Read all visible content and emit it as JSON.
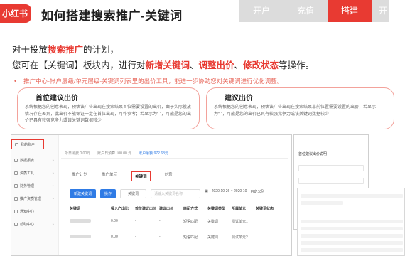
{
  "header": {
    "logo_text": "小红书",
    "title": "如何搭建搜索推广-关键词",
    "tabs": [
      {
        "label": "开户",
        "active": false
      },
      {
        "label": "充值",
        "active": false
      },
      {
        "label": "搭建",
        "active": true
      },
      {
        "label": "开",
        "active": false
      }
    ]
  },
  "intro": {
    "line1_pre": "对于投放",
    "line1_highlight": "搜索推广",
    "line1_post": "的计划，",
    "line2_pre": "您可在【关键词】板块内，进行对",
    "line2_h1": "新增关键词",
    "line2_sep1": "、",
    "line2_h2": "调整出价",
    "line2_sep2": "、",
    "line2_h3": "修改状态",
    "line2_post": "等操作。",
    "note": "推广中心-帐户层级/单元层级-关键词列表里的出价工具，能进一步协助您对关键词进行优化调整。"
  },
  "box_left": {
    "title": "首位建议出价",
    "body": "系统根据您的创意表现，预估该广告出现在搜索结果首位需要设置的出价，由于实际投放情况存在差异，此出价不能保证一定在首位出现，可作参考；若显示为“-”，可能是您的出价已具有较强竞争力或该关键词数据较少"
  },
  "box_right": {
    "title": "建议出价",
    "body": "系统根据您的创意表现，预估该广告出现在搜索结果靠前位置需要设置的出价；若显示为“-”，可能是您的出价已具有较强竞争力或该关键词数据较少"
  },
  "screenshot": {
    "sidebar": [
      {
        "label": "我的账户",
        "selected": true
      },
      {
        "label": "数据报表",
        "selected": false
      },
      {
        "label": "资质工具",
        "selected": false
      },
      {
        "label": "财务管理",
        "selected": false
      },
      {
        "label": "推广资质管理",
        "selected": false
      },
      {
        "label": "通知中心",
        "selected": false
      },
      {
        "label": "帮助中心",
        "selected": false
      }
    ],
    "topbar": [
      "今日消费 0.00元",
      "账户日预算 100.00 元",
      "账户余额 972.68元"
    ],
    "tabs": [
      "推广计划",
      "推广单元",
      "关键词",
      "创意"
    ],
    "active_tab": "关键词",
    "toolbar": {
      "add": "新建关键词",
      "ops": "操作",
      "filter": "关键词",
      "search_placeholder": "请输入关键词名称",
      "date_range": "2020-10-26 ~ 2020-10",
      "customize": "自定义列"
    },
    "columns": [
      "关键词",
      "投入产出比",
      "首位建议出价",
      "建议出价",
      "匹配方式",
      "关键词类型",
      "所属单元",
      "关键词状态"
    ],
    "rows": [
      [
        "",
        "0.00",
        "-",
        "-",
        "短语匹配",
        "关键词",
        "测试单元1",
        ""
      ],
      [
        "",
        "0.00",
        "-",
        "-",
        "短语匹配",
        "关键词",
        "测试单元2",
        ""
      ]
    ]
  },
  "popup": {
    "title": "首位建议出价说明"
  }
}
